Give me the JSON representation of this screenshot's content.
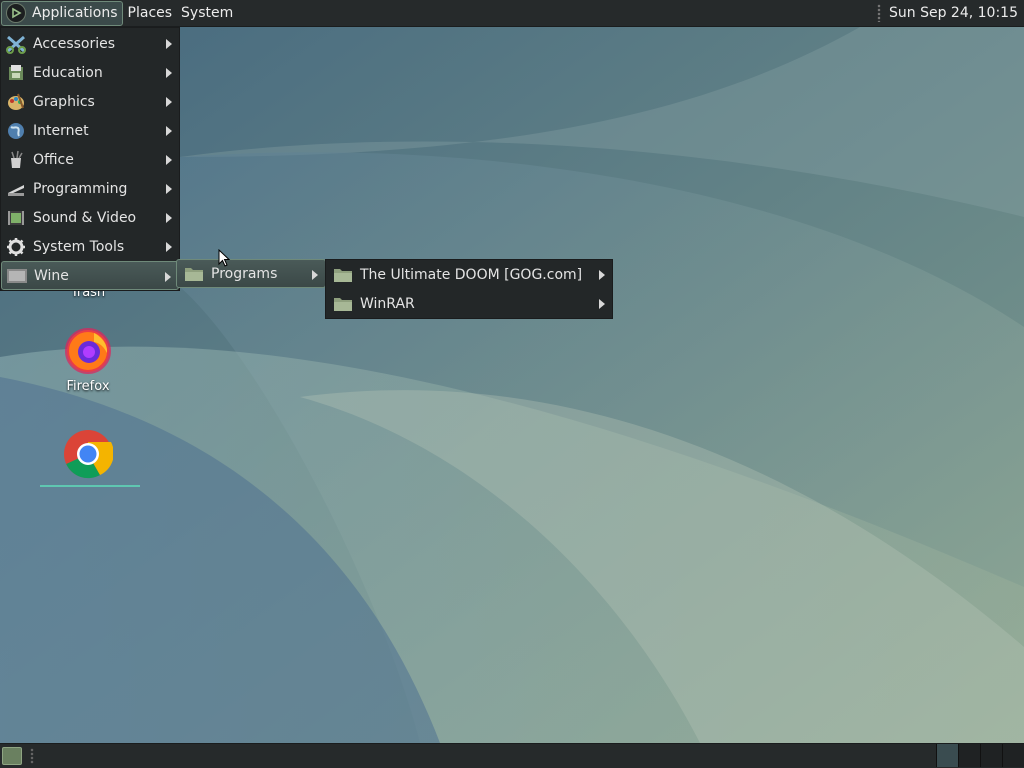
{
  "top_panel": {
    "applications": "Applications",
    "places": "Places",
    "system": "System",
    "clock": "Sun Sep 24, 10:15"
  },
  "apps_menu": {
    "items": [
      {
        "label": "Accessories",
        "icon": "accessories-icon"
      },
      {
        "label": "Education",
        "icon": "education-icon"
      },
      {
        "label": "Graphics",
        "icon": "graphics-icon"
      },
      {
        "label": "Internet",
        "icon": "internet-icon"
      },
      {
        "label": "Office",
        "icon": "office-icon"
      },
      {
        "label": "Programming",
        "icon": "programming-icon"
      },
      {
        "label": "Sound & Video",
        "icon": "sound-video-icon"
      },
      {
        "label": "System Tools",
        "icon": "system-tools-icon"
      },
      {
        "label": "Wine",
        "icon": "wine-icon"
      }
    ]
  },
  "wine_menu": {
    "items": [
      {
        "label": "Programs",
        "icon": "folder-icon"
      }
    ]
  },
  "programs_menu": {
    "items": [
      {
        "label": "The Ultimate DOOM [GOG.com]",
        "icon": "folder-icon"
      },
      {
        "label": "WinRAR",
        "icon": "folder-icon"
      }
    ]
  },
  "desktop_icons": [
    {
      "label": "Trash",
      "icon": "trash-icon"
    },
    {
      "label": "Firefox",
      "icon": "firefox-icon"
    },
    {
      "label": "",
      "icon": "chrome-icon"
    }
  ],
  "colors": {
    "panel": "#262a2b",
    "menu": "#232728",
    "highlight_border": "#6f8a7a"
  }
}
